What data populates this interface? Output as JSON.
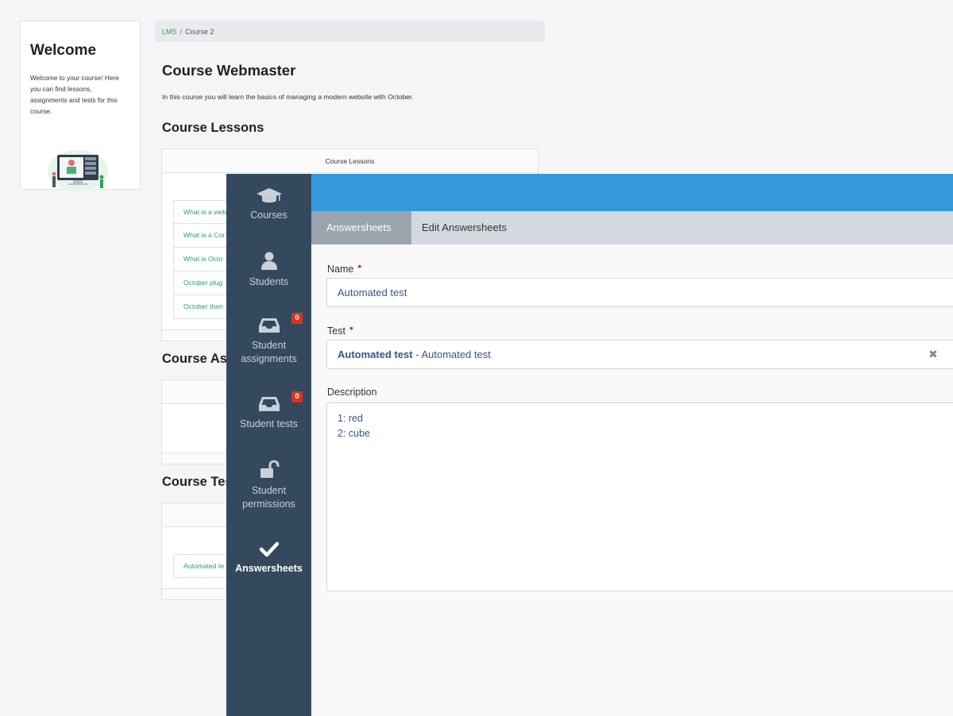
{
  "welcome": {
    "title": "Welcome",
    "text": "Welcome to your course! Here you can find lessons, assignments and tests for this course."
  },
  "breadcrumb": {
    "root": "LMS",
    "separator": "/",
    "current": "Course 2"
  },
  "course": {
    "title": "Course Webmaster",
    "intro": "In this course you will learn the basics of managing a modern website with October."
  },
  "lessons": {
    "heading": "Course Lessons",
    "table_header": "Course Lessons",
    "items": [
      "What is a web",
      "What is a Cor",
      "What is Octo",
      "October plug",
      "October then"
    ]
  },
  "assignments": {
    "heading": "Course Ass"
  },
  "tests": {
    "heading": "Course Tes",
    "items": [
      "Automated te"
    ]
  },
  "sidenav": {
    "items": [
      {
        "label": "Courses",
        "icon": "graduation-cap-icon"
      },
      {
        "label": "Students",
        "icon": "user-icon"
      },
      {
        "label": "Student assignments",
        "icon": "inbox-icon",
        "badge": "0"
      },
      {
        "label": "Student tests",
        "icon": "inbox-icon",
        "badge": "0"
      },
      {
        "label": "Student permissions",
        "icon": "unlock-icon"
      },
      {
        "label": "Answersheets",
        "icon": "check-icon",
        "active": true
      }
    ]
  },
  "backend_breadcrumb": {
    "parent": "Answersheets",
    "current": "Edit Answersheets"
  },
  "form": {
    "name_label": "Name",
    "name_value": "Automated test",
    "test_label": "Test",
    "test_value_bold": "Automated test",
    "test_value_rest": " - Automated test",
    "description_label": "Description",
    "description_value": "1: red\n2: cube"
  },
  "colors": {
    "primary": "#3498db",
    "sidebar": "#34495e",
    "link": "#2e9e5b",
    "badge": "#d9341e"
  }
}
